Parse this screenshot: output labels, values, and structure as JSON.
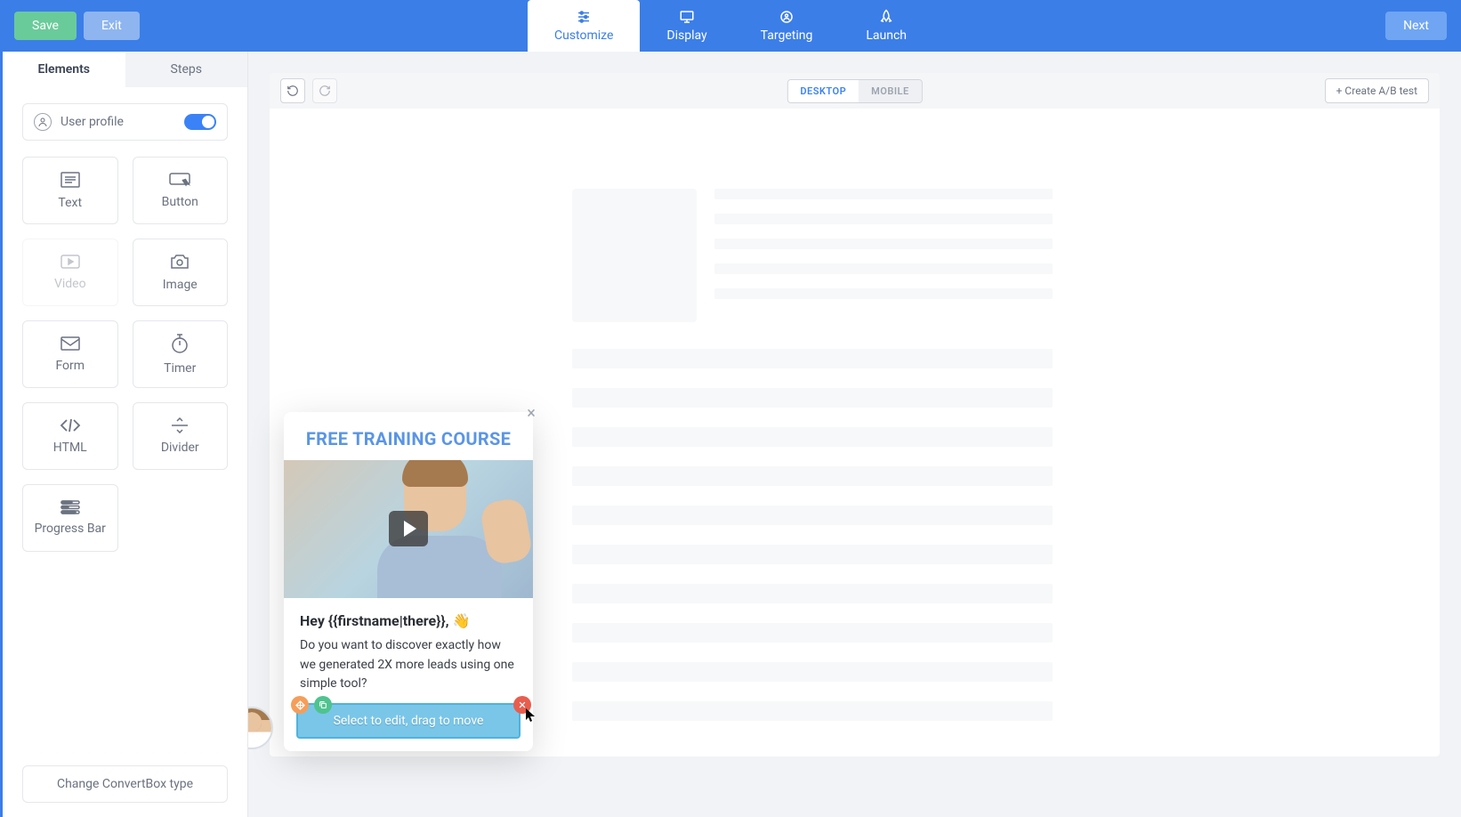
{
  "topbar": {
    "save": "Save",
    "exit": "Exit",
    "next": "Next",
    "tabs": [
      {
        "id": "customize",
        "label": "Customize"
      },
      {
        "id": "display",
        "label": "Display"
      },
      {
        "id": "targeting",
        "label": "Targeting"
      },
      {
        "id": "launch",
        "label": "Launch"
      }
    ]
  },
  "sidebar": {
    "tabs": {
      "elements": "Elements",
      "steps": "Steps"
    },
    "userProfile": {
      "label": "User profile",
      "enabled": true
    },
    "elements": [
      {
        "id": "text",
        "label": "Text"
      },
      {
        "id": "button",
        "label": "Button"
      },
      {
        "id": "video",
        "label": "Video",
        "disabled": true
      },
      {
        "id": "image",
        "label": "Image"
      },
      {
        "id": "form",
        "label": "Form"
      },
      {
        "id": "timer",
        "label": "Timer"
      },
      {
        "id": "html",
        "label": "HTML"
      },
      {
        "id": "divider",
        "label": "Divider"
      },
      {
        "id": "progress",
        "label": "Progress Bar"
      }
    ],
    "changeType": "Change ConvertBox type"
  },
  "canvasToolbar": {
    "undo": "Undo",
    "redo": "Redo",
    "views": {
      "desktop": "DESKTOP",
      "mobile": "MOBILE"
    },
    "abTest": "+ Create A/B test"
  },
  "popup": {
    "close": "×",
    "title": "FREE TRAINING COURSE",
    "greeting": "Hey {{firstname|there}}, ",
    "wave": "👋",
    "body": "Do you want to discover exactly how we generated 2X more leads using one simple tool?",
    "selectBar": "Select to edit, drag to move"
  }
}
